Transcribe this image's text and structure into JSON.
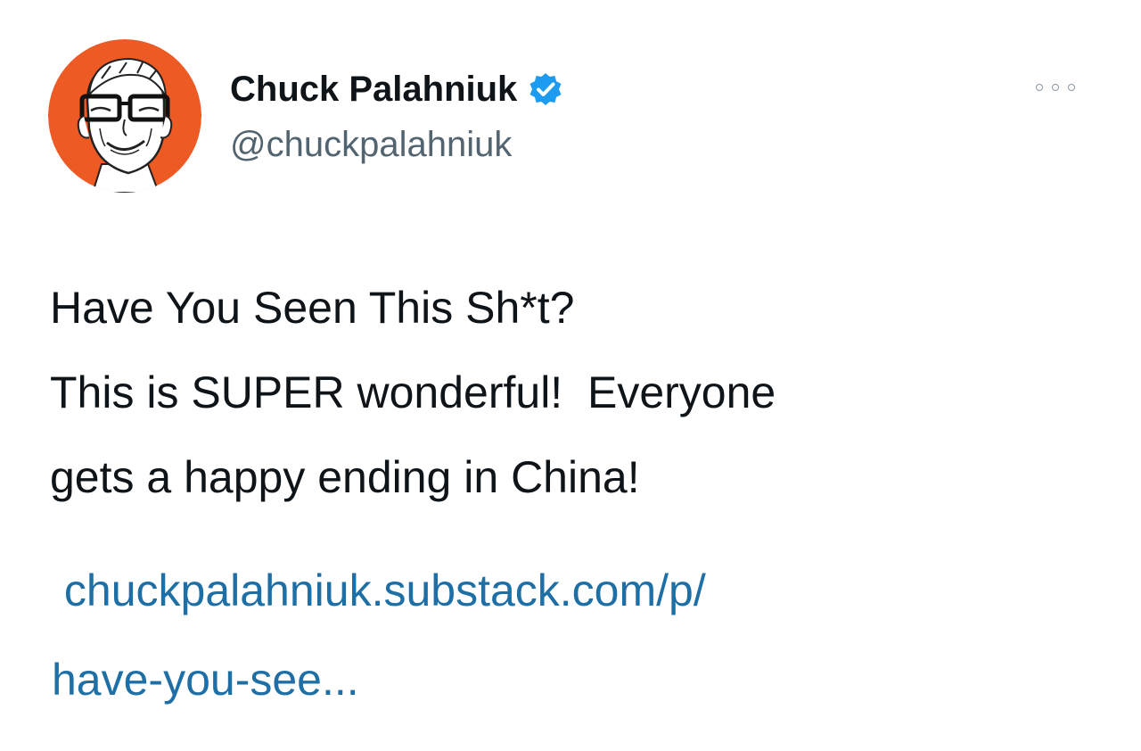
{
  "author": {
    "display_name": "Chuck Palahniuk",
    "handle": "@chuckpalahniuk",
    "verified": true,
    "avatar_icon": "caricature-avatar",
    "avatar_bg_color": "#ee5a24",
    "verified_color": "#1d9bf0"
  },
  "menu": {
    "more_icon": "more-options-icon"
  },
  "tweet": {
    "lines": [
      "Have You Seen This Sh*t?",
      "This is SUPER wonderful!  Everyone",
      "gets a happy ending in China!"
    ],
    "link_lines": [
      " chuckpalahniuk.substack.com/p/",
      "have-you-see..."
    ],
    "link_color": "#1d6fa5"
  }
}
